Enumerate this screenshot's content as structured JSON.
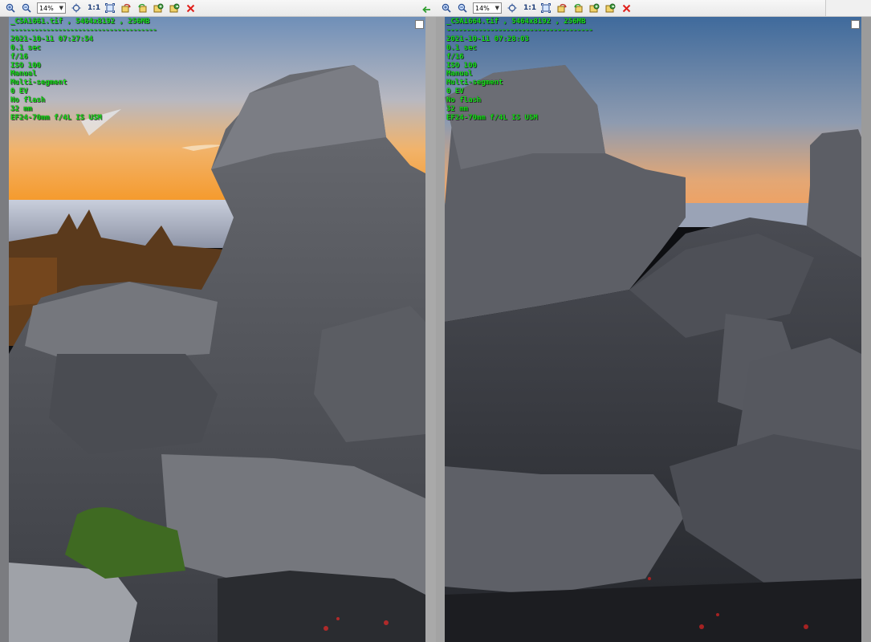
{
  "toolbar": {
    "zoom_value": "14%",
    "actual_size_label": "1:1"
  },
  "left": {
    "filename_line": "_C5A1661.tif , 5464x8192 , 256MB",
    "separator": "-------------------------------------",
    "datetime": "2021-10-11 07:27:54",
    "shutter": "0.1 sec",
    "aperture": "f/16",
    "iso": "ISO 100",
    "mode": "Manual",
    "metering": "Multi-segment",
    "ev": "0 EV",
    "flash": "No flash",
    "focal": "32 mm",
    "lens": "EF24-70mm f/4L IS USM"
  },
  "right": {
    "filename_line": "_C5A1664.tif , 5464x8192 , 256MB",
    "separator": "-------------------------------------",
    "datetime": "2021-10-11 07:28:03",
    "shutter": "0.1 sec",
    "aperture": "f/16",
    "iso": "ISO 100",
    "mode": "Manual",
    "metering": "Multi-segment",
    "ev": "0 EV",
    "flash": "No flash",
    "focal": "32 mm",
    "lens": "EF24-70mm f/4L IS USM"
  },
  "colors": {
    "overlay_text": "#19e31b",
    "close_red": "#e0201b",
    "sync_green": "#2f9d2f"
  }
}
